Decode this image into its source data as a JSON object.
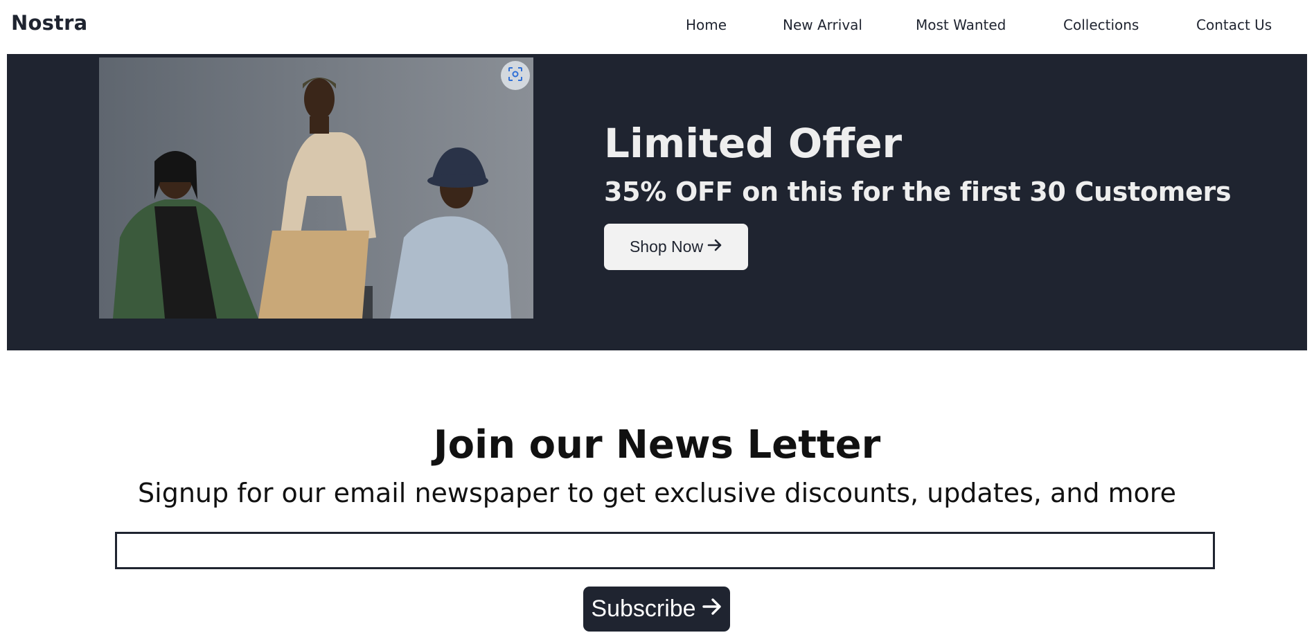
{
  "header": {
    "brand": "Nostra",
    "nav": [
      "Home",
      "New Arrival",
      "Most Wanted",
      "Collections",
      "Contact Us"
    ]
  },
  "hero": {
    "title": "Limited Offer",
    "subtitle": "35% OFF on this for the first 30 Customers",
    "button_label": "Shop Now",
    "button_icon": "arrow-right-icon",
    "image_overlay_icon": "visual-search-icon"
  },
  "newsletter": {
    "title": "Join our News Letter",
    "subtitle": "Signup for our email newspaper to get exclusive discounts, updates, and more",
    "email_value": "",
    "email_placeholder": "",
    "button_label": "Subscribe",
    "button_icon": "arrow-right-icon"
  },
  "colors": {
    "dark": "#1f2430",
    "light_button": "#f2f2f2",
    "hero_text": "#eeeeee"
  }
}
